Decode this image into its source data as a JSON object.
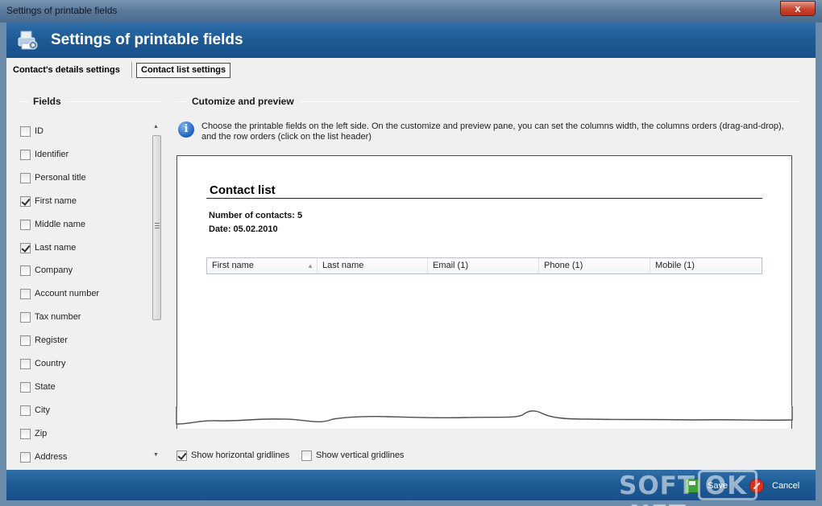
{
  "window": {
    "title": "Settings of printable fields",
    "close_label": "x"
  },
  "header": {
    "title": "Settings of printable fields",
    "icon": "printer-settings-icon"
  },
  "tabs": [
    {
      "label": "Contact's details settings",
      "active": false
    },
    {
      "label": "Contact list settings",
      "active": true
    }
  ],
  "fields_panel": {
    "title": "Fields",
    "items": [
      {
        "label": "ID",
        "checked": false
      },
      {
        "label": "Identifier",
        "checked": false
      },
      {
        "label": "Personal title",
        "checked": false
      },
      {
        "label": "First name",
        "checked": true
      },
      {
        "label": "Middle name",
        "checked": false
      },
      {
        "label": "Last name",
        "checked": true
      },
      {
        "label": "Company",
        "checked": false
      },
      {
        "label": "Account number",
        "checked": false
      },
      {
        "label": "Tax number",
        "checked": false
      },
      {
        "label": "Register",
        "checked": false
      },
      {
        "label": "Country",
        "checked": false
      },
      {
        "label": "State",
        "checked": false
      },
      {
        "label": "City",
        "checked": false
      },
      {
        "label": "Zip",
        "checked": false
      },
      {
        "label": "Address",
        "checked": false
      }
    ]
  },
  "preview_panel": {
    "title": "Cutomize and preview",
    "info_text": "Choose the printable fields on the left side. On the customize and preview pane, you can set the columns width, the columns orders (drag-and-drop), and the row orders (click on the list header)",
    "doc_title": "Contact list",
    "contacts_line": "Number of contacts: 5",
    "date_line": "Date: 05.02.2010",
    "columns": [
      "First name",
      "Last name",
      "Email (1)",
      "Phone (1)",
      "Mobile (1)"
    ]
  },
  "options": {
    "horizontal_gridlines": {
      "label": "Show horizontal gridlines",
      "checked": true
    },
    "vertical_gridlines": {
      "label": "Show vertical gridlines",
      "checked": false
    }
  },
  "footer": {
    "save_label": "Save",
    "cancel_label": "Cancel"
  },
  "watermark": {
    "text": "SOFT OK .NET"
  },
  "colors": {
    "header_blue": "#1d5a95",
    "panel_bg": "#f0f0f0"
  }
}
